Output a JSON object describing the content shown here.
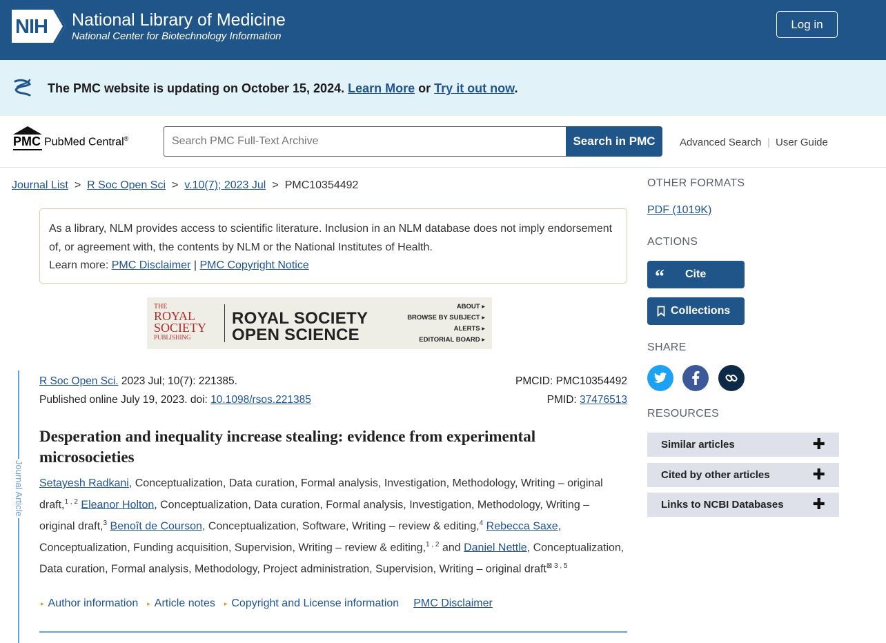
{
  "header": {
    "logo_text": "NIH",
    "title": "National Library of Medicine",
    "subtitle": "National Center for Biotechnology Information",
    "login_label": "Log in"
  },
  "banner": {
    "text": "The PMC website is updating on October 15, 2024.",
    "learn_more": "Learn More",
    "or_text": "or",
    "try_it": "Try it out now",
    "period": "."
  },
  "pmc": {
    "logo_abbr": "PMC",
    "logo_name": "PubMed Central",
    "logo_reg": "®",
    "search_placeholder": "Search PMC Full-Text Archive",
    "search_button": "Search in PMC",
    "advanced_search": "Advanced Search",
    "separator": "|",
    "user_guide": "User Guide"
  },
  "breadcrumb": {
    "items": [
      "Journal List",
      "R Soc Open Sci",
      "v.10(7); 2023 Jul"
    ],
    "current": "PMC10354492",
    "separator": ">"
  },
  "disclaimer": {
    "text": "As a library, NLM provides access to scientific literature. Inclusion in an NLM database does not imply endorsement of, or agreement with, the contents by NLM or the National Institutes of Health.",
    "learn_more": "Learn more:",
    "link1": "PMC Disclaimer",
    "sep": "|",
    "link2": "PMC Copyright Notice"
  },
  "journal_banner": {
    "publisher_the": "THE",
    "publisher_line1": "ROYAL",
    "publisher_line2": "SOCIETY",
    "publisher_line3": "PUBLISHING",
    "title_line1": "ROYAL SOCIETY",
    "title_line2": "OPEN SCIENCE",
    "links": [
      "ABOUT ▸",
      "BROWSE BY SUBJECT ▸",
      "ALERTS ▸",
      "EDITORIAL BOARD ▸"
    ]
  },
  "article": {
    "side_label": "Journal Article",
    "journal": "R Soc Open Sci.",
    "citation": "2023 Jul; 10(7): 221385.",
    "published": "Published online July 19, 2023. doi:",
    "doi": "10.1098/rsos.221385",
    "pmcid_label": "PMCID: PMC10354492",
    "pmid_label": "PMID:",
    "pmid": "37476513",
    "title": "Desperation and inequality increase stealing: evidence from experimental microsocieties",
    "authors": [
      {
        "name": "Setayesh Radkani",
        "roles": ", Conceptualization, Data curation, Formal analysis, Investigation, Methodology, Writing – original draft,",
        "sup": "1 , 2"
      },
      {
        "name": "Eleanor Holton",
        "roles": ", Conceptualization, Data curation, Formal analysis, Investigation, Methodology, Writing – original draft,",
        "sup": "3"
      },
      {
        "name": "Benoît de Courson",
        "roles": ", Conceptualization, Software, Writing – review & editing,",
        "sup": "4"
      },
      {
        "name": "Rebecca Saxe",
        "roles": ", Conceptualization, Funding acquisition, Supervision, Writing – review & editing,",
        "sup": "1 , 2"
      },
      {
        "name": "Daniel Nettle",
        "roles": ", Conceptualization, Data curation, Formal analysis, Methodology, Project administration, Supervision, Writing – original draft",
        "sup": "⊠ 3 , 5"
      }
    ],
    "and_text": "and",
    "info_links": [
      "Author information",
      "Article notes",
      "Copyright and License information"
    ],
    "pmc_disclaimer": "PMC Disclaimer"
  },
  "sidebar": {
    "other_formats": "OTHER FORMATS",
    "pdf": "PDF (1019K)",
    "actions": "ACTIONS",
    "cite": "Cite",
    "collections": "Collections",
    "share": "SHARE",
    "resources": "RESOURCES",
    "resource_items": [
      "Similar articles",
      "Cited by other articles",
      "Links to NCBI Databases"
    ],
    "colors": {
      "twitter": "#1da1f2",
      "facebook": "#3b5998",
      "link": "#0c2a48"
    }
  }
}
